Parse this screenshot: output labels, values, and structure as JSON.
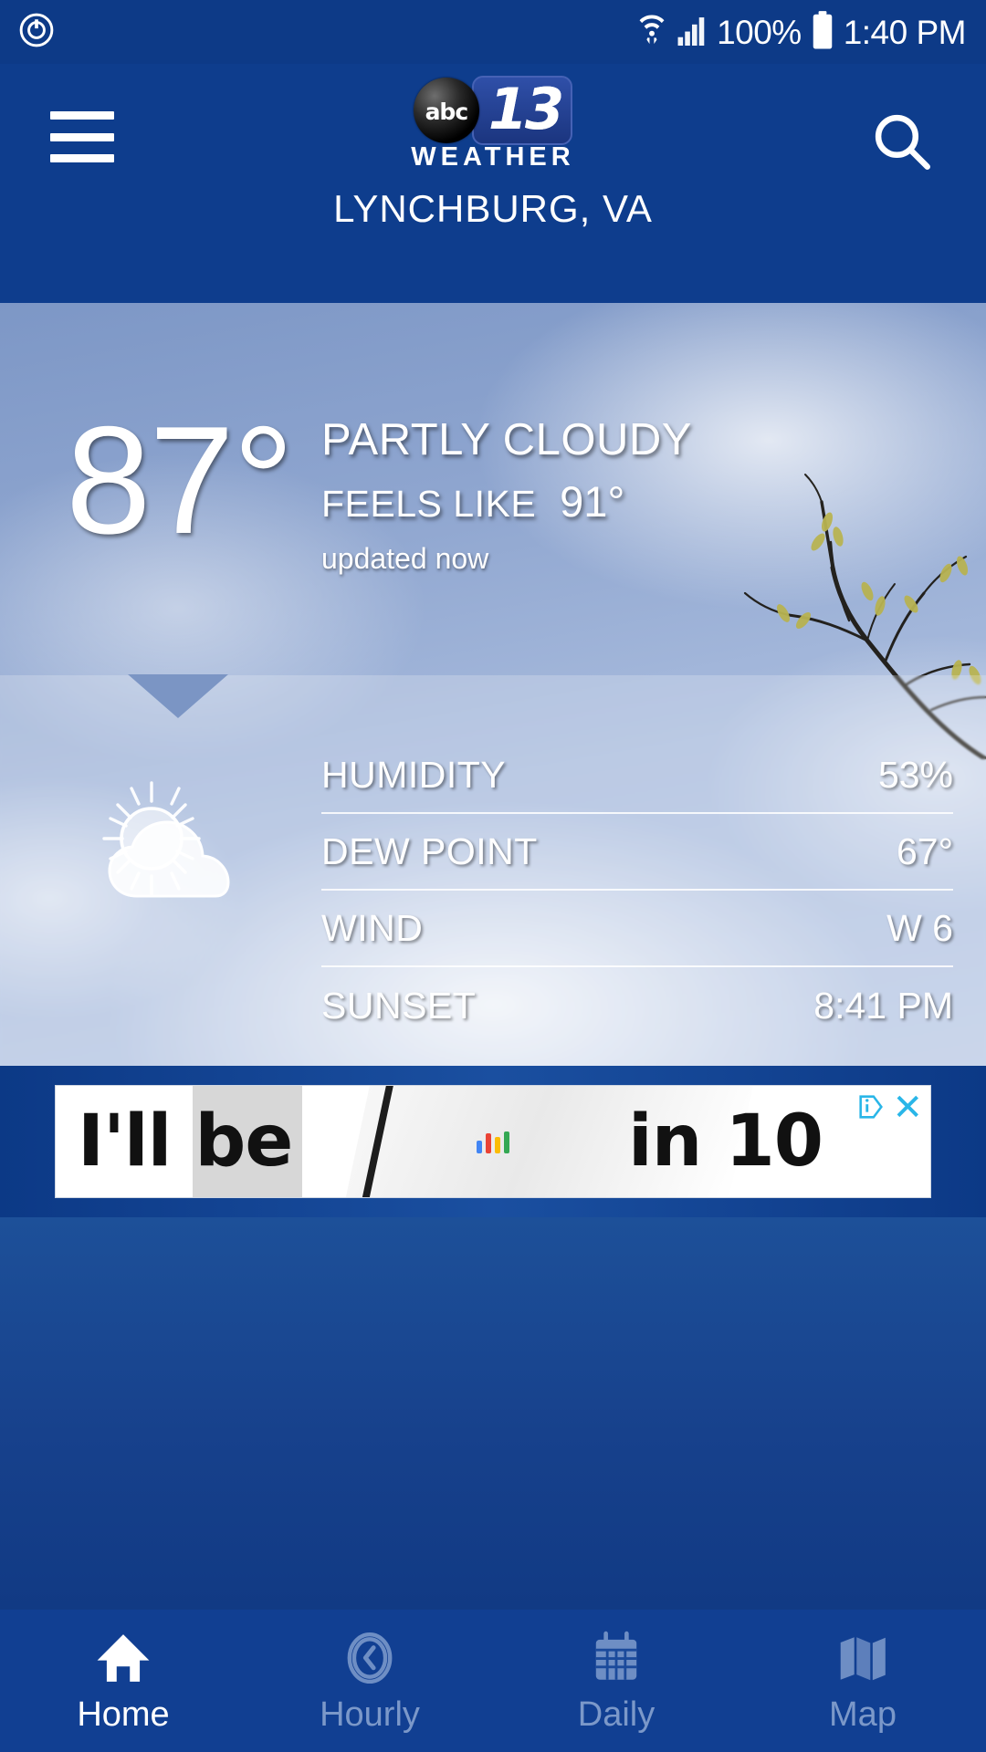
{
  "status_bar": {
    "power_icon": "power-circle-icon",
    "wifi_icon": "wifi-icon",
    "signal_icon": "cell-signal-icon",
    "battery_percent": "100%",
    "battery_icon": "battery-full-icon",
    "time": "1:40 PM"
  },
  "header": {
    "menu_icon": "hamburger-menu-icon",
    "search_icon": "search-icon",
    "logo": {
      "network": "abc",
      "channel": "13",
      "word": "WEATHER"
    },
    "location": "LYNCHBURG, VA",
    "bg_color": "#0e3d8d"
  },
  "current": {
    "temperature": "87°",
    "condition": "PARTLY CLOUDY",
    "feels_like_label": "FEELS LIKE",
    "feels_like_value": "91°",
    "updated": "updated now",
    "condition_icon": "sun-behind-cloud-icon"
  },
  "details": {
    "rows": [
      {
        "label": "HUMIDITY",
        "value": "53%"
      },
      {
        "label": "DEW POINT",
        "value": "67°"
      },
      {
        "label": "WIND",
        "value": "W 6"
      },
      {
        "label": "SUNSET",
        "value": "8:41 PM"
      }
    ]
  },
  "ad": {
    "text_left": "I'll be",
    "text_right": "in 10",
    "choices_icon": "adchoices-icon",
    "close_label": "✕"
  },
  "bottom_nav": {
    "items": [
      {
        "label": "Home",
        "icon": "home-icon",
        "active": true
      },
      {
        "label": "Hourly",
        "icon": "clock-icon",
        "active": false
      },
      {
        "label": "Daily",
        "icon": "calendar-icon",
        "active": false
      },
      {
        "label": "Map",
        "icon": "map-icon",
        "active": false
      }
    ],
    "active_color": "#ffffff",
    "inactive_color": "#7b98c9",
    "bg_color": "#113f92"
  }
}
